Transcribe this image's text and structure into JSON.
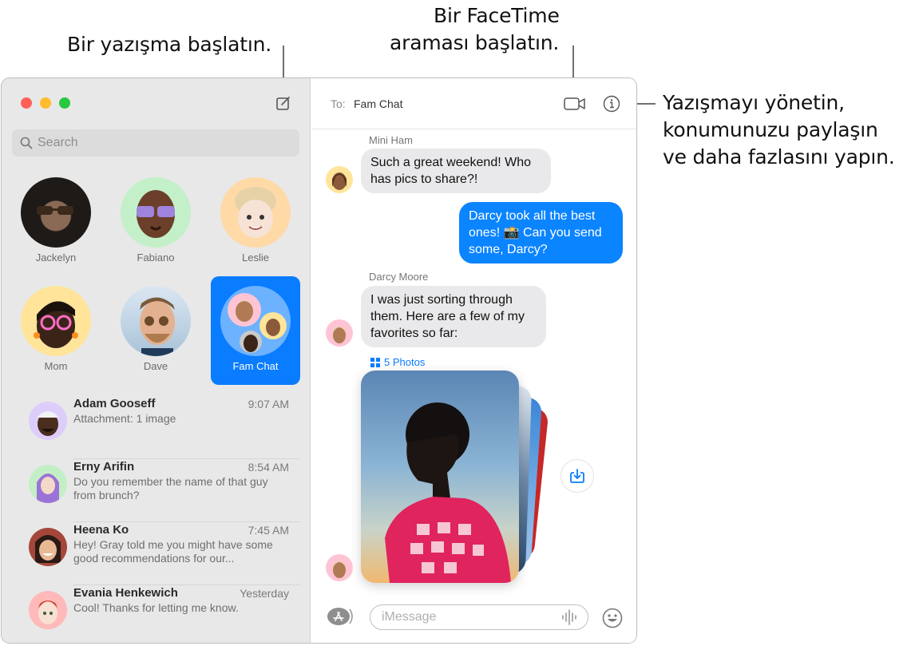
{
  "callouts": {
    "compose": "Bir yazışma başlatın.",
    "facetime_line1": "Bir FaceTime",
    "facetime_line2": "araması başlatın.",
    "details_line1": "Yazışmayı yönetin,",
    "details_line2": "konumunuzu paylaşın",
    "details_line3": "ve daha fazlasını yapın."
  },
  "window": {
    "traffic_lights": {
      "close": "#ff5f57",
      "minimize": "#febc2e",
      "zoom": "#28c840"
    },
    "compose_icon": "compose-icon"
  },
  "sidebar": {
    "search_placeholder": "Search",
    "pinned": [
      {
        "name": "Jackelyn",
        "bg": "#2b2623"
      },
      {
        "name": "Fabiano",
        "bg": "#c3f0c8"
      },
      {
        "name": "Leslie",
        "bg": "#ffd9a6"
      },
      {
        "name": "Mom",
        "bg": "#ffe49a"
      },
      {
        "name": "Dave",
        "bg": "#c9dbea"
      },
      {
        "name": "Fam Chat",
        "bg": "#6cb2ff",
        "selected": true
      }
    ],
    "conversations": [
      {
        "name": "Adam Gooseff",
        "time": "9:07 AM",
        "preview": "Attachment: 1 image",
        "bg": "#dccdfa"
      },
      {
        "name": "Erny Arifin",
        "time": "8:54 AM",
        "preview": "Do you remember the name of that guy from brunch?",
        "bg": "#c4efc6"
      },
      {
        "name": "Heena Ko",
        "time": "7:45 AM",
        "preview": "Hey! Gray told me you might have some good recommendations for our...",
        "bg": "#a4473a"
      },
      {
        "name": "Evania Henkewich",
        "time": "Yesterday",
        "preview": "Cool! Thanks for letting me know.",
        "bg": "#ffb9b9"
      }
    ]
  },
  "chat": {
    "to_label": "To:",
    "to_value": "Fam Chat",
    "header_icons": [
      "video-camera-icon",
      "info-icon"
    ],
    "messages": [
      {
        "sender": "Mini Ham",
        "direction": "incoming",
        "text": "Such a great weekend! Who has pics to share?!"
      },
      {
        "direction": "outgoing",
        "text": "Darcy took all the best ones! 📸 Can you send some, Darcy?"
      },
      {
        "sender": "Darcy Moore",
        "direction": "incoming",
        "text": "I was just sorting through them. Here are a few of my favorites so far:"
      }
    ],
    "photos_label": "5 Photos",
    "photo_count": 5,
    "composer_placeholder": "iMessage",
    "accent": "#0b84ff"
  }
}
